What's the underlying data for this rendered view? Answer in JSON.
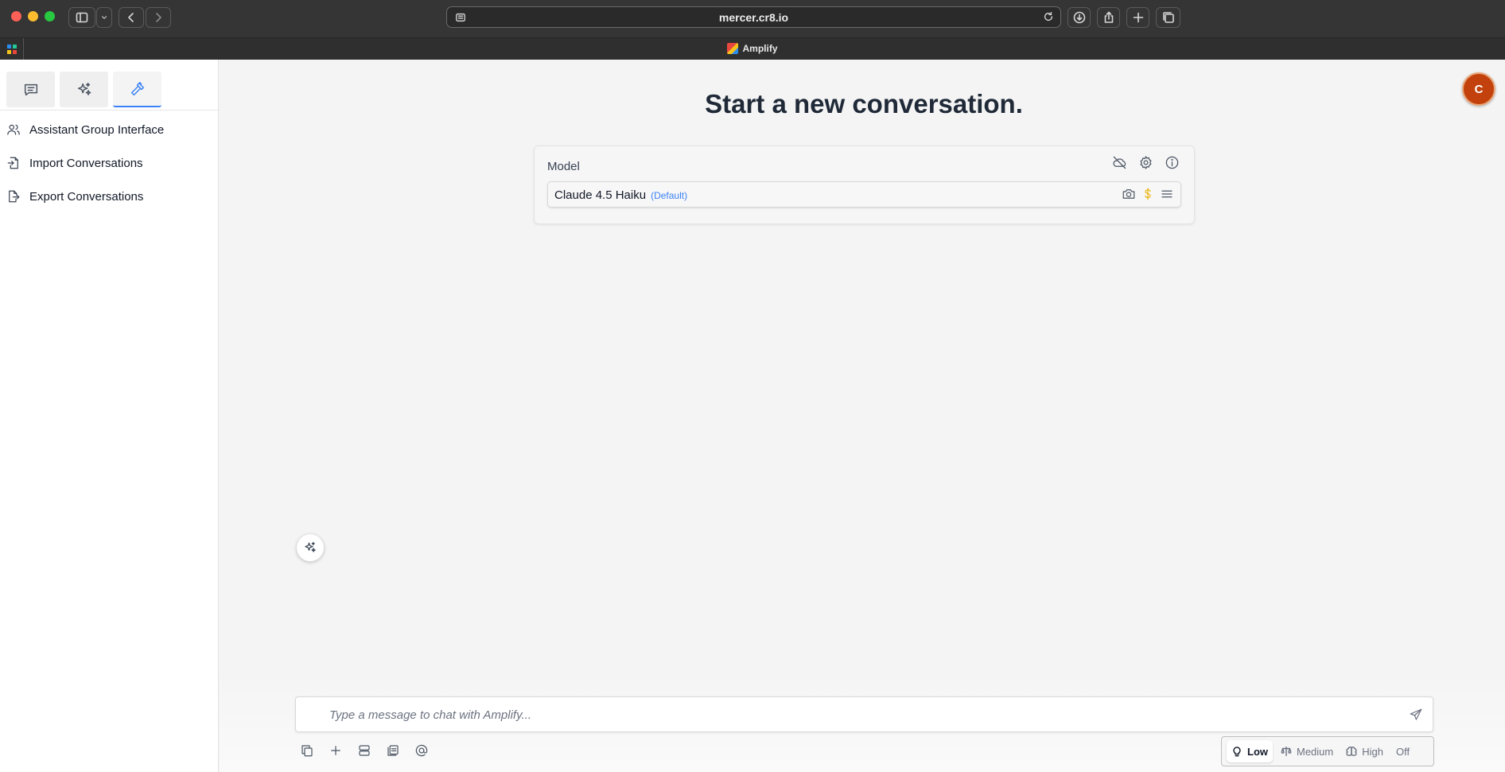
{
  "browser": {
    "url": "mercer.cr8.io",
    "tab_title": "Amplify"
  },
  "sidebar": {
    "tabs": [
      {
        "icon": "chat-icon",
        "active": false
      },
      {
        "icon": "sparkles-icon",
        "active": false
      },
      {
        "icon": "hammer-icon",
        "active": true
      }
    ],
    "items": [
      {
        "label": "Assistant Group Interface",
        "icon": "users-icon"
      },
      {
        "label": "Import Conversations",
        "icon": "file-import-icon"
      },
      {
        "label": "Export Conversations",
        "icon": "file-export-icon"
      }
    ]
  },
  "main": {
    "heading": "Start a new conversation.",
    "avatar_initial": "C",
    "model_card": {
      "label": "Model",
      "selected_model": "Claude 4.5 Haiku",
      "default_tag": "(Default)"
    },
    "chat": {
      "placeholder": "Type a message to chat with Amplify..."
    },
    "effort": {
      "options": [
        "Low",
        "Medium",
        "High",
        "Off"
      ],
      "selected": "Low"
    }
  },
  "colors": {
    "accent": "#3b82f6",
    "avatar": "#c2410c",
    "dollar": "#eab308"
  }
}
